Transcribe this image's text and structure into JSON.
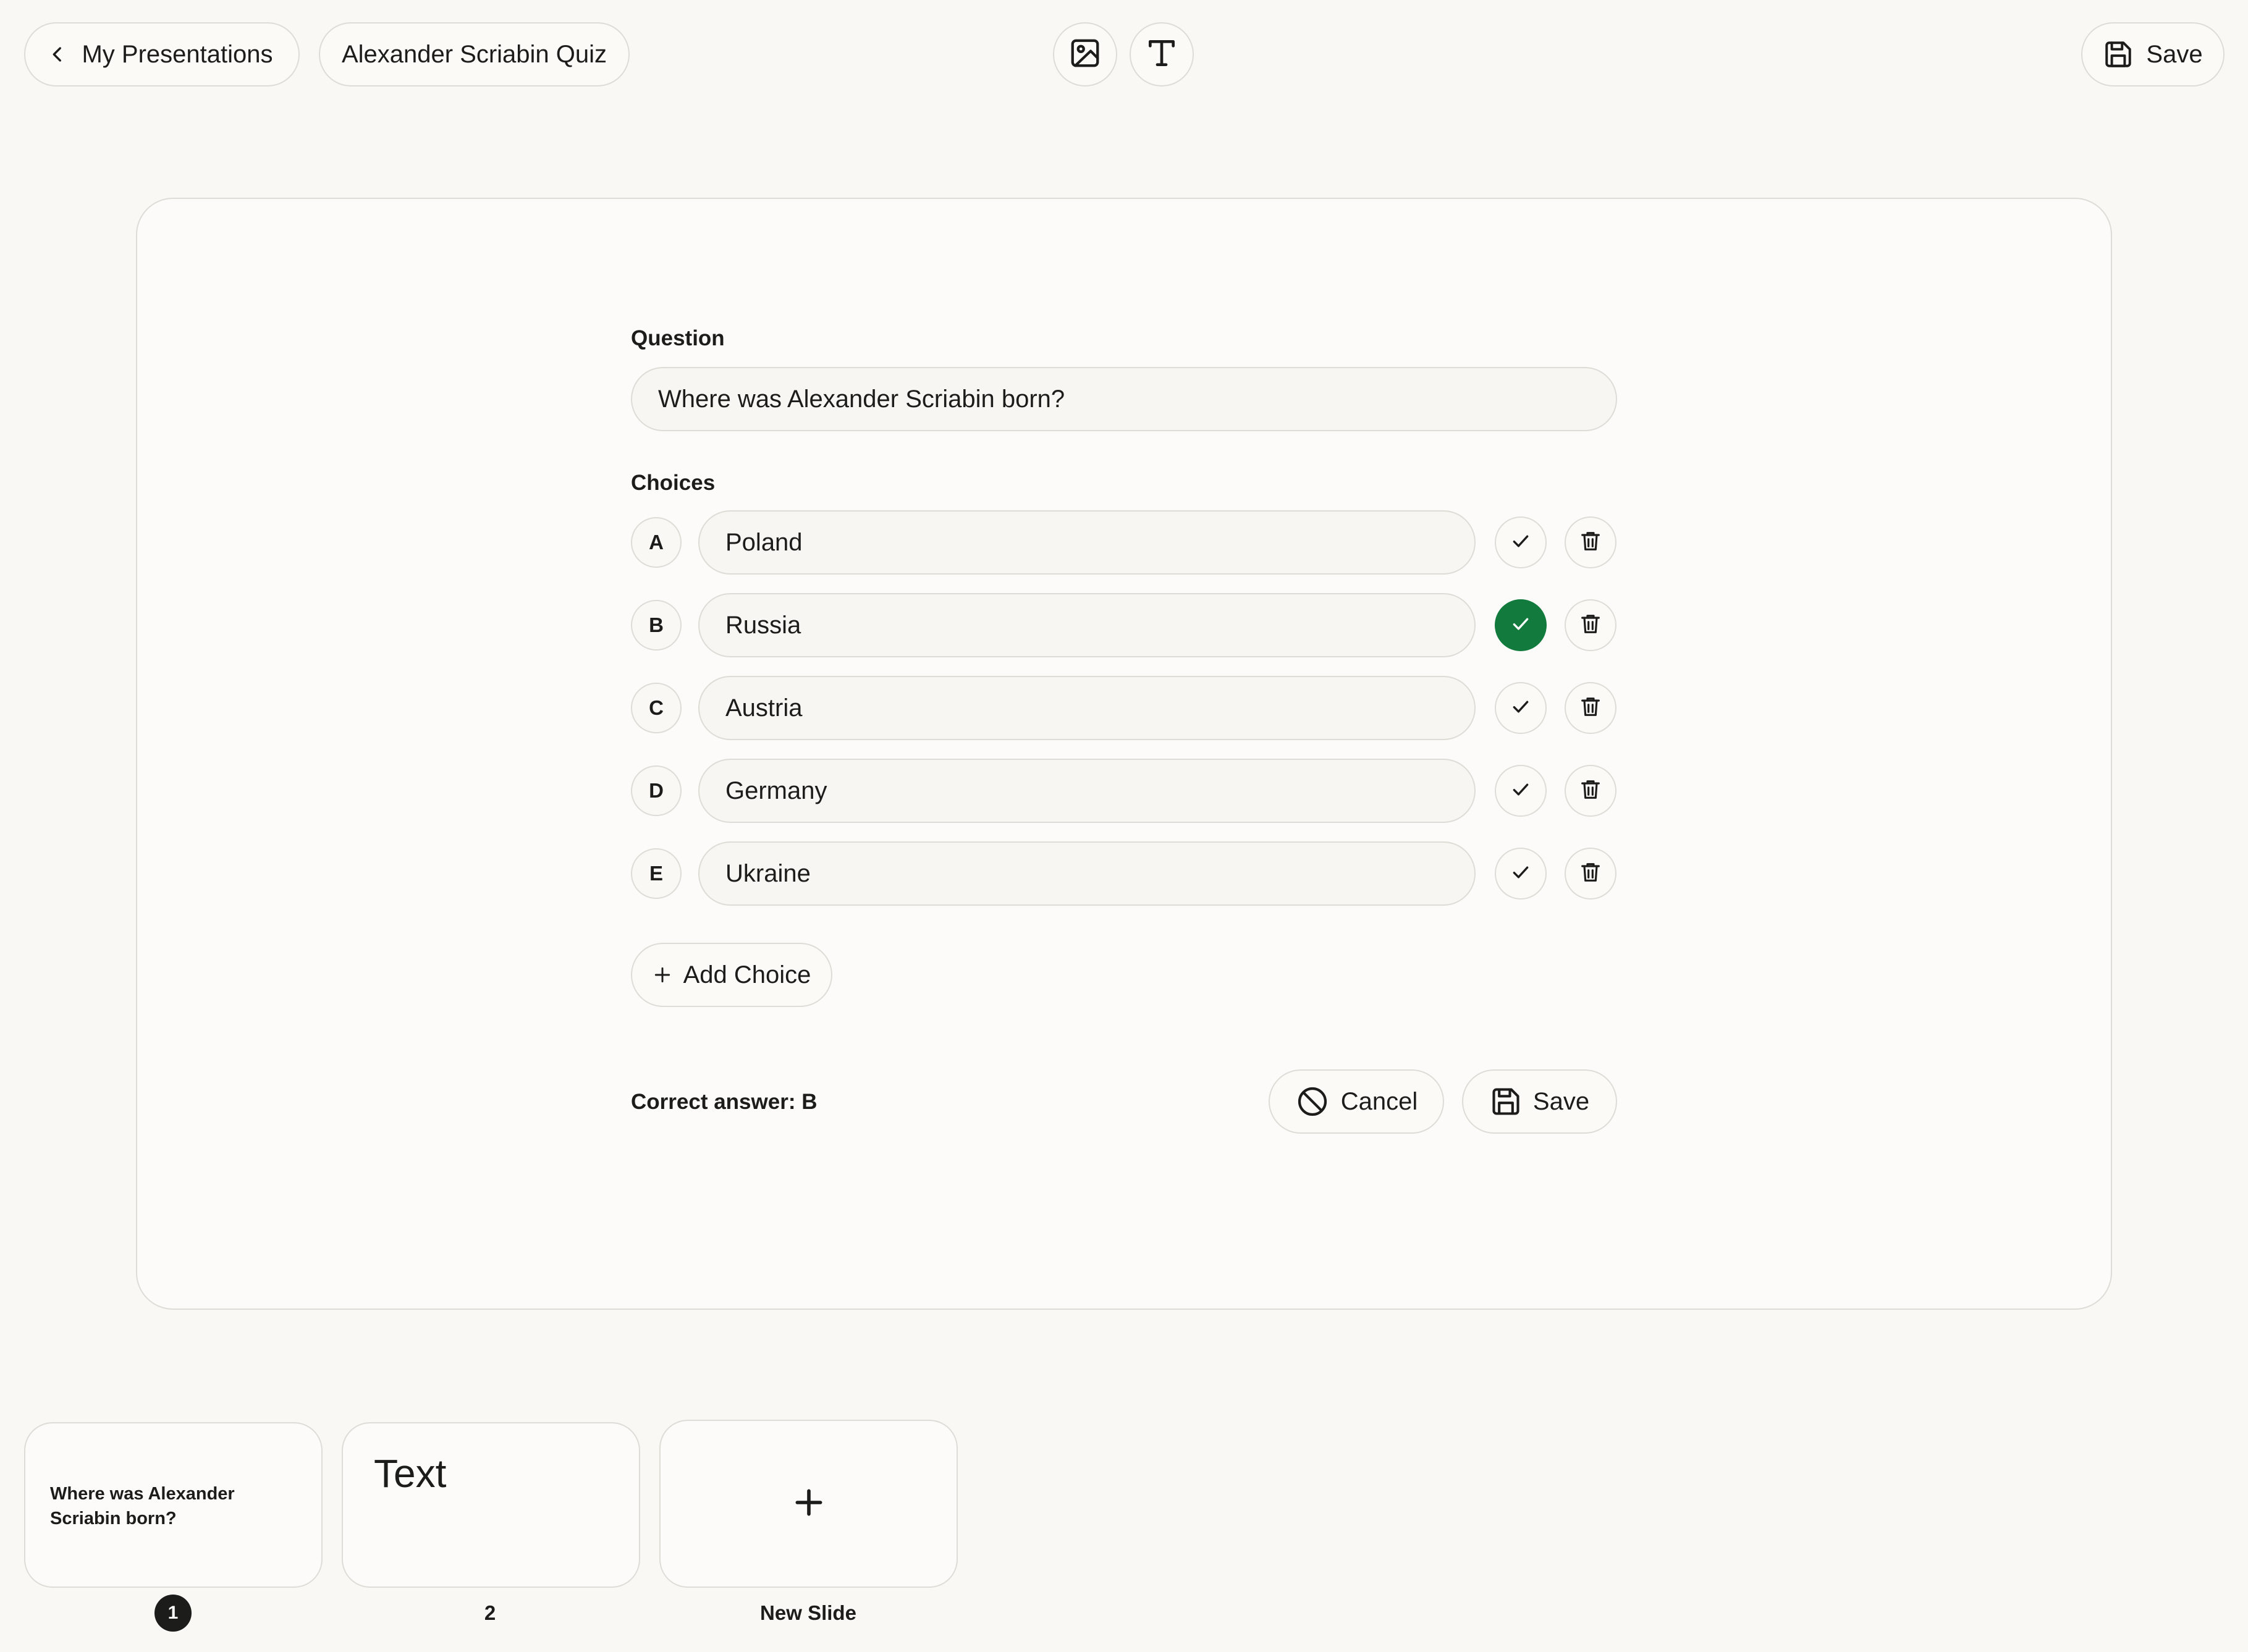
{
  "header": {
    "back_label": "My Presentations",
    "presentation_title": "Alexander Scriabin Quiz",
    "save_label": "Save",
    "tools": [
      "image-icon",
      "text-icon"
    ]
  },
  "editor": {
    "question_label": "Question",
    "question_value": "Where was Alexander Scriabin born?",
    "choices_label": "Choices",
    "choices": [
      {
        "letter": "A",
        "value": "Poland",
        "correct": false
      },
      {
        "letter": "B",
        "value": "Russia",
        "correct": true
      },
      {
        "letter": "C",
        "value": "Austria",
        "correct": false
      },
      {
        "letter": "D",
        "value": "Germany",
        "correct": false
      },
      {
        "letter": "E",
        "value": "Ukraine",
        "correct": false
      }
    ],
    "add_choice_label": "Add Choice",
    "correct_answer_text": "Correct answer: B",
    "cancel_label": "Cancel",
    "save_label": "Save"
  },
  "slides": [
    {
      "number": "1",
      "preview": "Where was Alexander Scriabin born?",
      "active": true
    },
    {
      "number": "2",
      "preview": "Text",
      "active": false
    }
  ],
  "new_slide_label": "New Slide",
  "colors": {
    "background": "#f9f8f5",
    "border": "#dedcd6",
    "correct_green": "#117a3c",
    "text": "#1c1c1a"
  }
}
